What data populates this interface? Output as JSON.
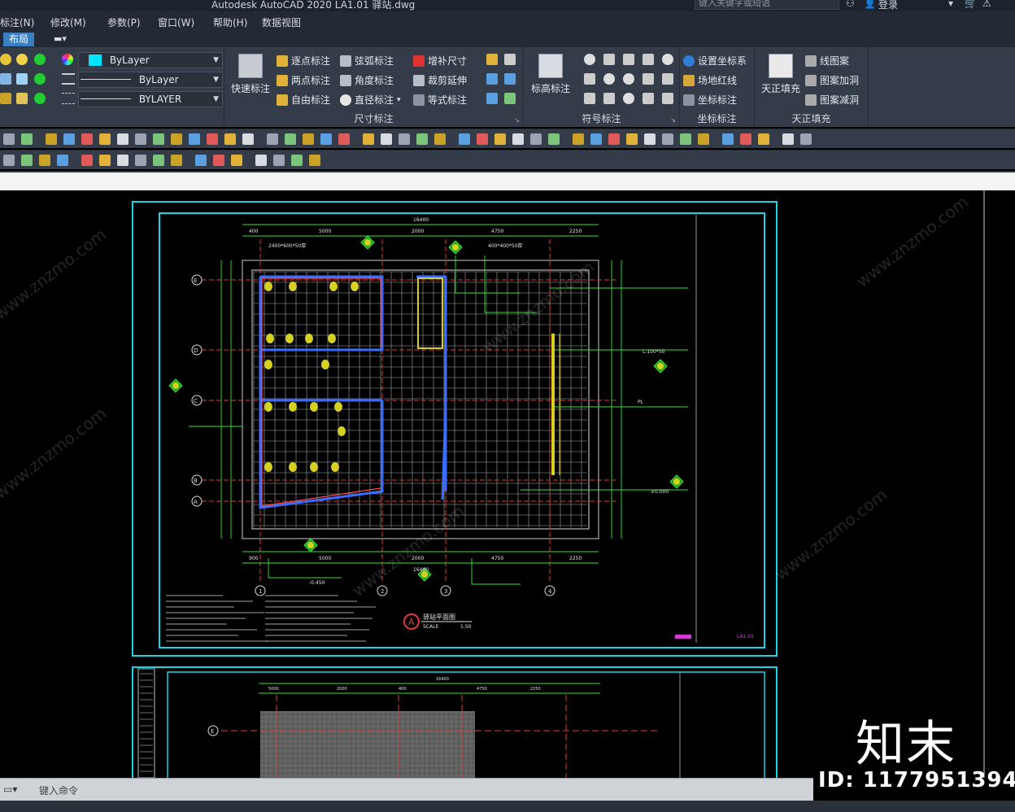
{
  "titlebar": {
    "app_title": "Autodesk AutoCAD 2020    LA1.01 驿站.dwg",
    "search_placeholder": "键入关键字或短语",
    "login": "登录"
  },
  "menu": {
    "items": [
      "标注(N)",
      "修改(M)",
      "参数(P)",
      "窗口(W)",
      "帮助(H)",
      "数据视图"
    ]
  },
  "tabs": {
    "active": "布局"
  },
  "ribbon": {
    "layer": {
      "color_value": "ByLayer",
      "linetype_value": "ByLayer",
      "lineweight_value": "BYLAYER"
    },
    "dimension_panel": {
      "title": "尺寸标注",
      "quick_dim": "快速标注",
      "buttons": [
        "逐点标注",
        "两点标注",
        "自由标注",
        "弦弧标注",
        "角度标注",
        "直径标注",
        "增补尺寸",
        "裁剪延伸",
        "等式标注"
      ]
    },
    "symbol_panel": {
      "title": "符号标注",
      "elev": "标高标注"
    },
    "coord_panel": {
      "title": "坐标标注",
      "buttons": [
        "设置坐标系",
        "场地红线",
        "坐标标注"
      ]
    },
    "fill_panel": {
      "title": "天正填充",
      "big": "天正填充",
      "buttons": [
        "线图案",
        "图案加洞",
        "图案减洞"
      ]
    }
  },
  "command": {
    "placeholder": "键入命令"
  },
  "drawing": {
    "sheet_title": "驿站平面图",
    "scale_label": "SCALE",
    "scale_value": "1:50",
    "sheet_no": "LA1.01",
    "detail_marker": "A",
    "grid_rows": [
      "E",
      "D",
      "C",
      "B",
      "A"
    ],
    "grid_cols": [
      "1",
      "2",
      "3",
      "4"
    ],
    "overall_dim": "16400",
    "dims_top": [
      "400",
      "5000",
      "2000",
      "4750",
      "2250"
    ],
    "dims_bottom": [
      "900",
      "5000",
      "2000",
      "4750",
      "2250"
    ],
    "lower_dims": [
      "16400",
      "5000",
      "2000",
      "400",
      "4750",
      "2250"
    ],
    "annotations": [
      "2400*600*50厚",
      "400*400*50厚",
      "L:100*50",
      "PL",
      "±0.000",
      "-0.450"
    ]
  },
  "watermark": {
    "logo": "知末",
    "id": "ID: 1177951394",
    "site": "www.znzmo.com"
  }
}
